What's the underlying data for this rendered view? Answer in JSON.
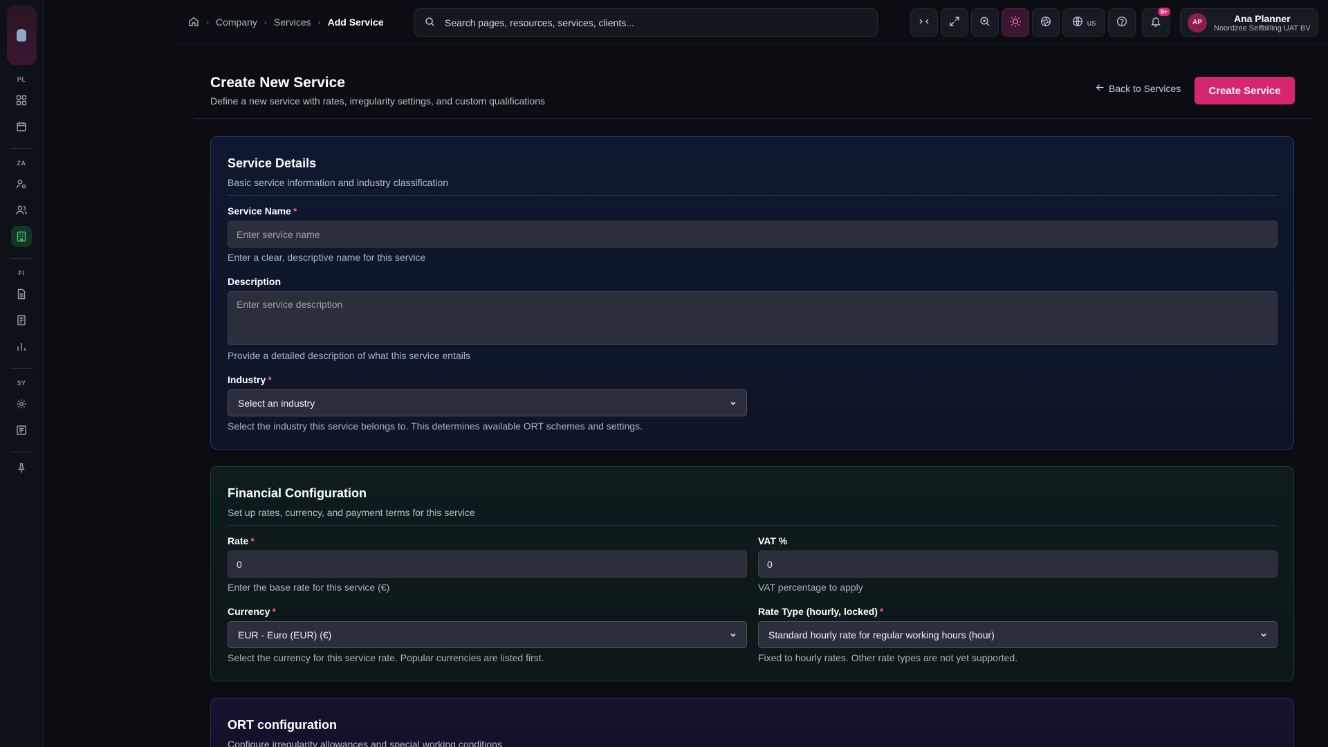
{
  "rail": {
    "sections": [
      "PL",
      "ZA",
      "FI",
      "SY"
    ]
  },
  "breadcrumb": {
    "items": [
      "Company",
      "Services"
    ],
    "current": "Add Service"
  },
  "search": {
    "placeholder": "Search pages, resources, services, clients..."
  },
  "topbar": {
    "locale": "us",
    "notifications_badge": "9+"
  },
  "user": {
    "initials": "AP",
    "name": "Ana Planner",
    "org": "Noordzee Selfbilling UAT BV"
  },
  "page": {
    "title": "Create New Service",
    "subtitle": "Define a new service with rates, irregularity settings, and custom qualifications",
    "back_label": "Back to Services",
    "create_label": "Create Service"
  },
  "service_details": {
    "title": "Service Details",
    "subtitle": "Basic service information and industry classification",
    "name_label": "Service Name",
    "name_placeholder": "Enter service name",
    "name_hint": "Enter a clear, descriptive name for this service",
    "desc_label": "Description",
    "desc_placeholder": "Enter service description",
    "desc_hint": "Provide a detailed description of what this service entails",
    "industry_label": "Industry",
    "industry_value": "Select an industry",
    "industry_hint": "Select the industry this service belongs to. This determines available ORT schemes and settings."
  },
  "financial": {
    "title": "Financial Configuration",
    "subtitle": "Set up rates, currency, and payment terms for this service",
    "rate_label": "Rate",
    "rate_value": "0",
    "rate_hint": "Enter the base rate for this service (€)",
    "vat_label": "VAT %",
    "vat_value": "0",
    "vat_hint": "VAT percentage to apply",
    "currency_label": "Currency",
    "currency_value": "EUR - Euro (EUR) (€)",
    "currency_hint": "Select the currency for this service rate. Popular currencies are listed first.",
    "rate_type_label": "Rate Type (hourly, locked)",
    "rate_type_value": "Standard hourly rate for regular working hours (hour)",
    "rate_type_hint": "Fixed to hourly rates. Other rate types are not yet supported."
  },
  "ort": {
    "title": "ORT configuration",
    "subtitle": "Configure irregularity allowances and special working conditions"
  },
  "colors": {
    "accent": "#d6266f",
    "required": "#ff5c8a"
  }
}
